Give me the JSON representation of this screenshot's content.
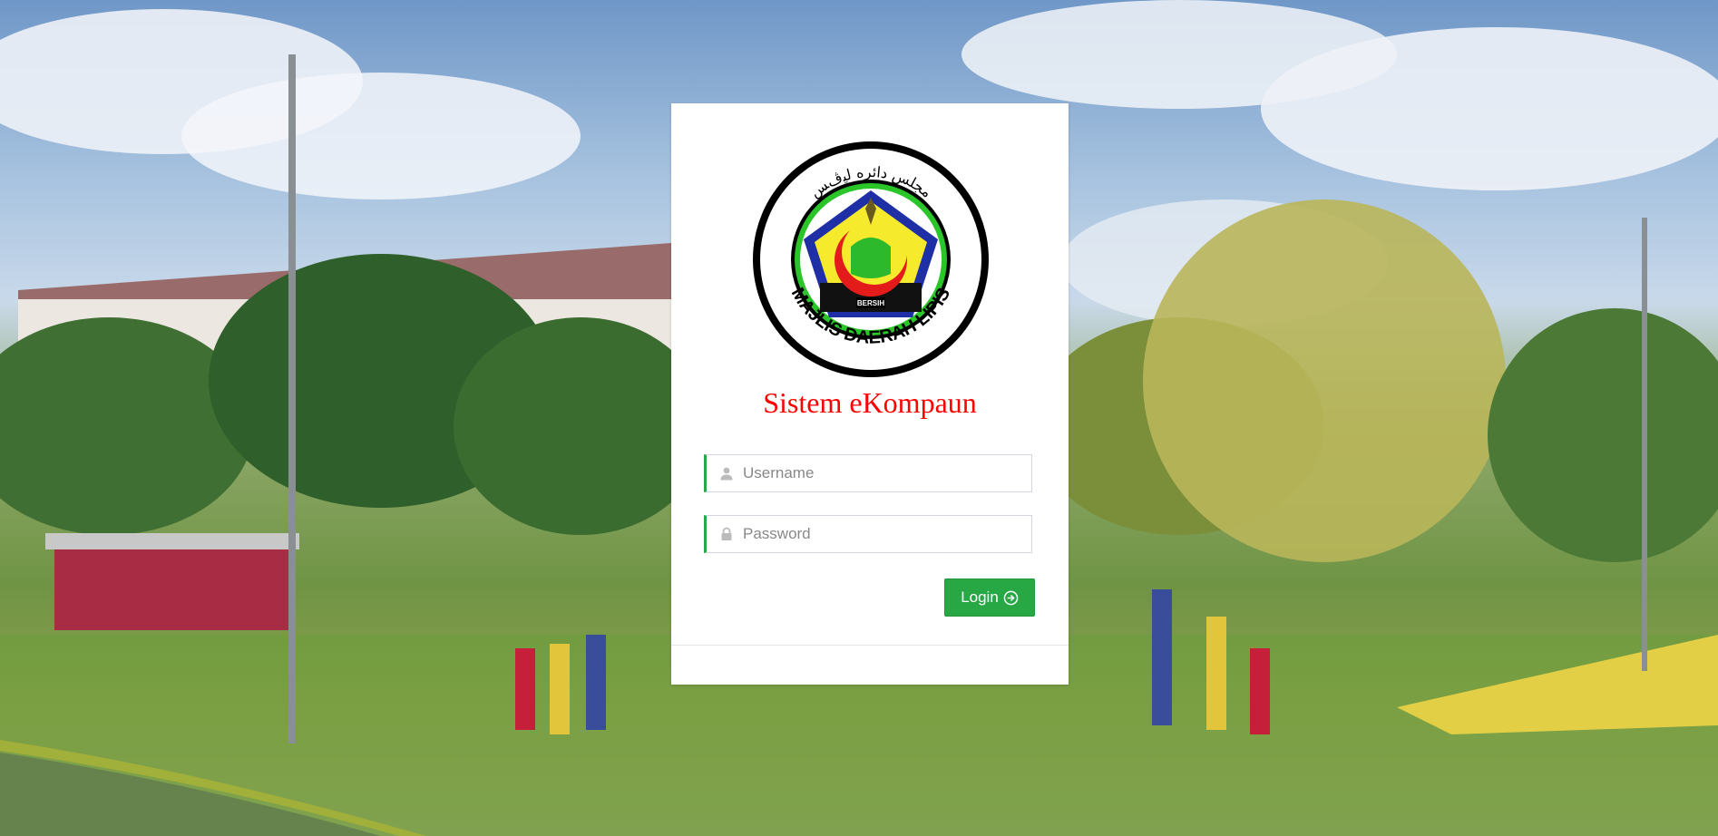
{
  "app": {
    "title": "Sistem eKompaun",
    "logo_text_bottom": "MAJLIS DAERAH LIPIS",
    "logo_text_badge": "BERSIH"
  },
  "form": {
    "username": {
      "placeholder": "Username",
      "value": ""
    },
    "password": {
      "placeholder": "Password",
      "value": ""
    },
    "login_label": "Login"
  },
  "icons": {
    "username": "user-icon",
    "password": "lock-icon",
    "login": "arrow-circle-right-icon"
  },
  "colors": {
    "title": "#ff0000",
    "accent": "#28a745",
    "card": "#ffffff"
  }
}
